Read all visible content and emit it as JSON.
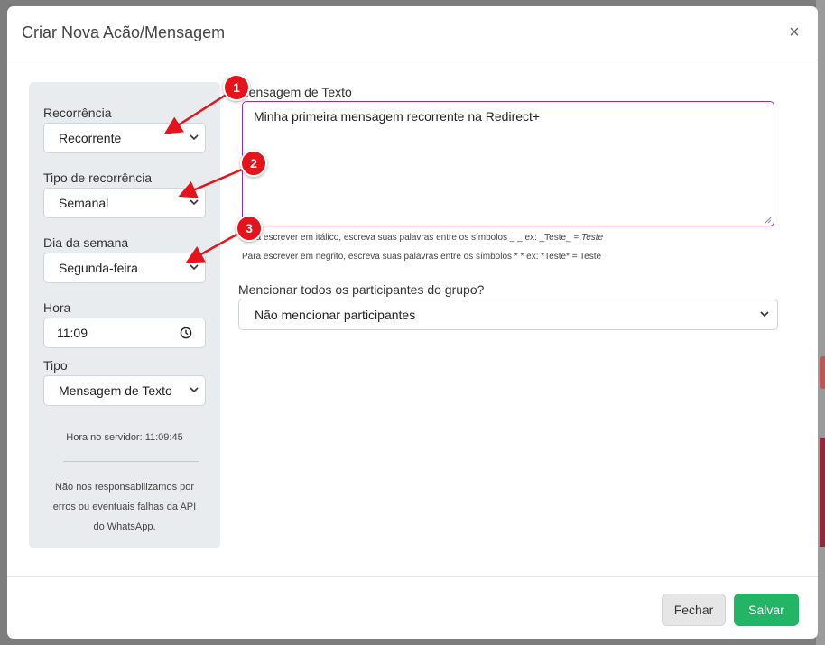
{
  "modal": {
    "title": "Criar Nova Acão/Mensagem",
    "close_symbol": "×"
  },
  "sidebar": {
    "recurrence_label": "Recorrência",
    "recurrence_value": "Recorrente",
    "recurrence_type_label": "Tipo de recorrência",
    "recurrence_type_value": "Semanal",
    "weekday_label": "Dia da semana",
    "weekday_value": "Segunda-feira",
    "time_label": "Hora",
    "time_value": "11:09",
    "type_label": "Tipo",
    "type_value": "Mensagem de Texto",
    "server_time": "Hora no servidor: 11:09:45",
    "disclaimer": "Não nos responsabilizamos por erros ou eventuais falhas da API do WhatsApp."
  },
  "message": {
    "label": "Mensagem de Texto",
    "value": "Minha primeira mensagem recorrente na Redirect+",
    "hint_italic_prefix": "Para escrever em itálico, escreva suas palavras entre os símbolos _ _ ex: _Teste_ = ",
    "hint_italic_example": "Teste",
    "hint_bold": "Para escrever em negrito, escreva suas palavras entre os símbolos * * ex: *Teste* = Teste"
  },
  "mention": {
    "label": "Mencionar todos os participantes do grupo?",
    "value": "Não mencionar participantes"
  },
  "footer": {
    "close_label": "Fechar",
    "save_label": "Salvar"
  },
  "annotations": {
    "badge_1": "1",
    "badge_2": "2",
    "badge_3": "3"
  },
  "colors": {
    "accent_purple": "#8a2ec2",
    "save_green": "#21b565",
    "annotation_red": "#e3141b"
  }
}
